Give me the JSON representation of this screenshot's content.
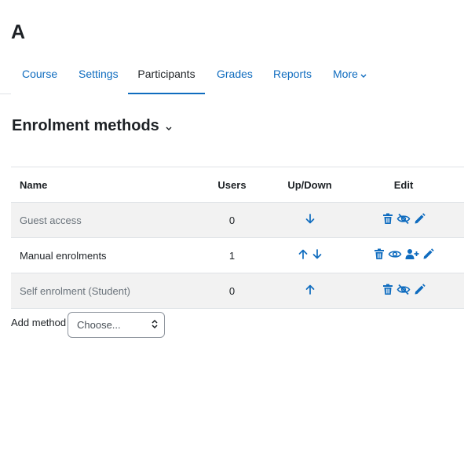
{
  "course": {
    "title": "A"
  },
  "tabs": [
    {
      "label": "Course"
    },
    {
      "label": "Settings"
    },
    {
      "label": "Participants",
      "active": true
    },
    {
      "label": "Grades"
    },
    {
      "label": "Reports"
    },
    {
      "label": "More"
    }
  ],
  "page": {
    "heading": "Enrolment methods"
  },
  "table": {
    "headers": {
      "name": "Name",
      "users": "Users",
      "updown": "Up/Down",
      "edit": "Edit"
    },
    "rows": [
      {
        "name": "Guest access",
        "users": "0",
        "enabled": false,
        "updown": [
          "down"
        ],
        "edit": [
          "delete-icon",
          "hide-icon",
          "edit-icon"
        ]
      },
      {
        "name": "Manual enrolments",
        "users": "1",
        "enabled": true,
        "updown": [
          "up",
          "down"
        ],
        "edit": [
          "delete-icon",
          "show-icon",
          "enrol-users-icon",
          "edit-icon"
        ]
      },
      {
        "name": "Self enrolment (Student)",
        "users": "0",
        "enabled": false,
        "updown": [
          "up"
        ],
        "edit": [
          "delete-icon",
          "hide-icon",
          "edit-icon"
        ]
      }
    ]
  },
  "add_method": {
    "label": "Add method",
    "selected": "Choose..."
  },
  "colors": {
    "link": "#0f6cbf",
    "text": "#1d2125",
    "muted": "#6a737b",
    "row_stripe": "#f2f2f2",
    "border": "#dee2e6"
  }
}
